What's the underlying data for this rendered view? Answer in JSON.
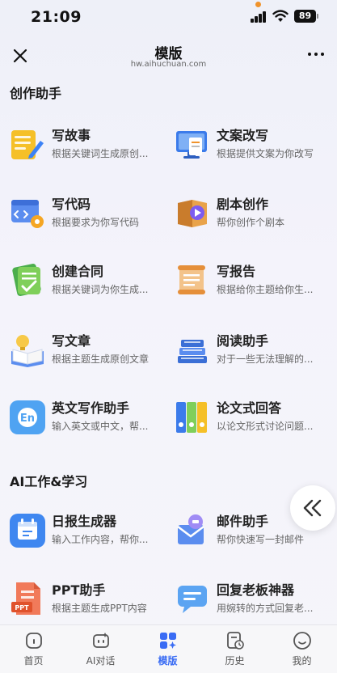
{
  "status": {
    "time": "21:09",
    "battery": "89"
  },
  "nav": {
    "title": "模版",
    "url": "hw.aihuchuan.com"
  },
  "sections": [
    {
      "title": "创作助手",
      "items": [
        {
          "title": "写故事",
          "desc": "根据关键词生成原创...",
          "icon": "notepad-pencil-icon"
        },
        {
          "title": "文案改写",
          "desc": "根据提供文案为你改写",
          "icon": "monitor-document-icon"
        },
        {
          "title": "写代码",
          "desc": "根据要求为你写代码",
          "icon": "code-window-gear-icon"
        },
        {
          "title": "剧本创作",
          "desc": "帮你创作个剧本",
          "icon": "film-book-icon"
        },
        {
          "title": "创建合同",
          "desc": "根据关键词为你生成...",
          "icon": "contract-check-icon"
        },
        {
          "title": "写报告",
          "desc": "根据给你主题给你生...",
          "icon": "scroll-report-icon"
        },
        {
          "title": "写文章",
          "desc": "根据主题生成原创文章",
          "icon": "book-lightbulb-icon"
        },
        {
          "title": "阅读助手",
          "desc": "对于一些无法理解的...",
          "icon": "books-stack-icon"
        },
        {
          "title": "英文写作助手",
          "desc": "输入英文或中文，帮...",
          "icon": "en-badge-icon"
        },
        {
          "title": "论文式回答",
          "desc": "以论文形式讨论问题...",
          "icon": "binders-icon"
        }
      ]
    },
    {
      "title": "AI工作&学习",
      "items": [
        {
          "title": "日报生成器",
          "desc": "输入工作内容，帮你...",
          "icon": "calendar-icon"
        },
        {
          "title": "邮件助手",
          "desc": "帮你快速写一封邮件",
          "icon": "envelope-icon"
        },
        {
          "title": "PPT助手",
          "desc": "根据主题生成PPT内容",
          "icon": "ppt-file-icon"
        },
        {
          "title": "回复老板神器",
          "desc": "用婉转的方式回复老...",
          "icon": "chat-bubble-icon"
        }
      ]
    }
  ],
  "tabs": [
    {
      "label": "首页",
      "icon": "home-icon"
    },
    {
      "label": "AI对话",
      "icon": "ai-chat-icon"
    },
    {
      "label": "模版",
      "icon": "template-grid-icon",
      "active": true
    },
    {
      "label": "历史",
      "icon": "history-icon"
    },
    {
      "label": "我的",
      "icon": "profile-smile-icon"
    }
  ],
  "colors": {
    "accent": "#3a6cf4",
    "background": "#f4f3fb",
    "orange": "#f0932b"
  }
}
